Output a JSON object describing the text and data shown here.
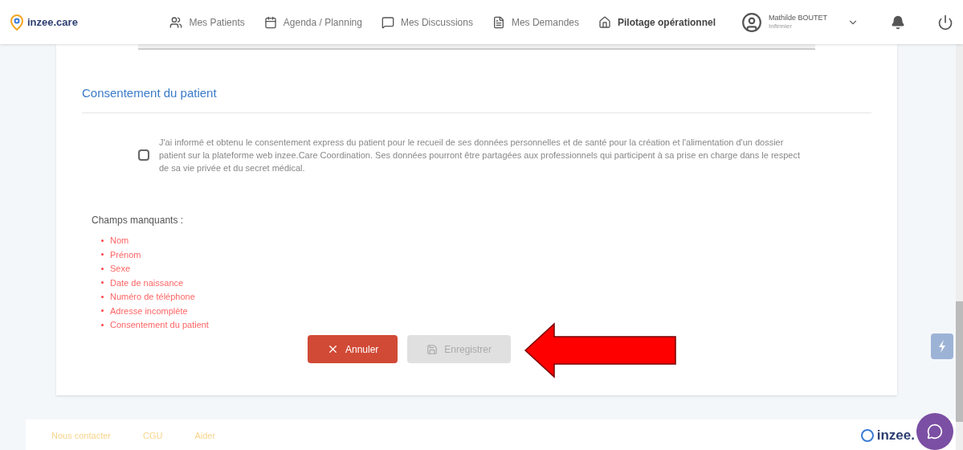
{
  "header": {
    "logo": "inzee.care",
    "nav": [
      {
        "label": "Mes Patients",
        "selected": false
      },
      {
        "label": "Agenda / Planning",
        "selected": false
      },
      {
        "label": "Mes Discussions",
        "selected": false
      },
      {
        "label": "Mes Demandes",
        "selected": false
      },
      {
        "label": "Pilotage opérationnel",
        "selected": true
      }
    ],
    "user": {
      "name": "Mathilde BOUTET",
      "role": "Infirmier"
    }
  },
  "consent": {
    "title": "Consentement du patient",
    "checked": false,
    "text": "J'ai informé et obtenu le consentement express du patient pour le recueil de ses données personnelles et de santé pour la création et l'alimentation d'un dossier patient sur la plateforme web inzee.Care Coordination. Ses données pourront être partagées aux professionnels qui participent à sa prise en charge dans le respect de sa vie privée et du secret médical."
  },
  "missing": {
    "title": "Champs manquants :",
    "items": [
      "Nom",
      "Prénom",
      "Sexe",
      "Date de naissance",
      "Numéro de téléphone",
      "Adresse incomplète",
      "Consentement du patient"
    ]
  },
  "buttons": [
    {
      "label": "Annuler",
      "kind": "cancel",
      "disabled": false
    },
    {
      "label": "Enregistrer",
      "kind": "save",
      "disabled": true
    }
  ],
  "footer": {
    "links": [
      "Nous contacter",
      "CGU",
      "Aider"
    ],
    "logo": "inzee."
  }
}
